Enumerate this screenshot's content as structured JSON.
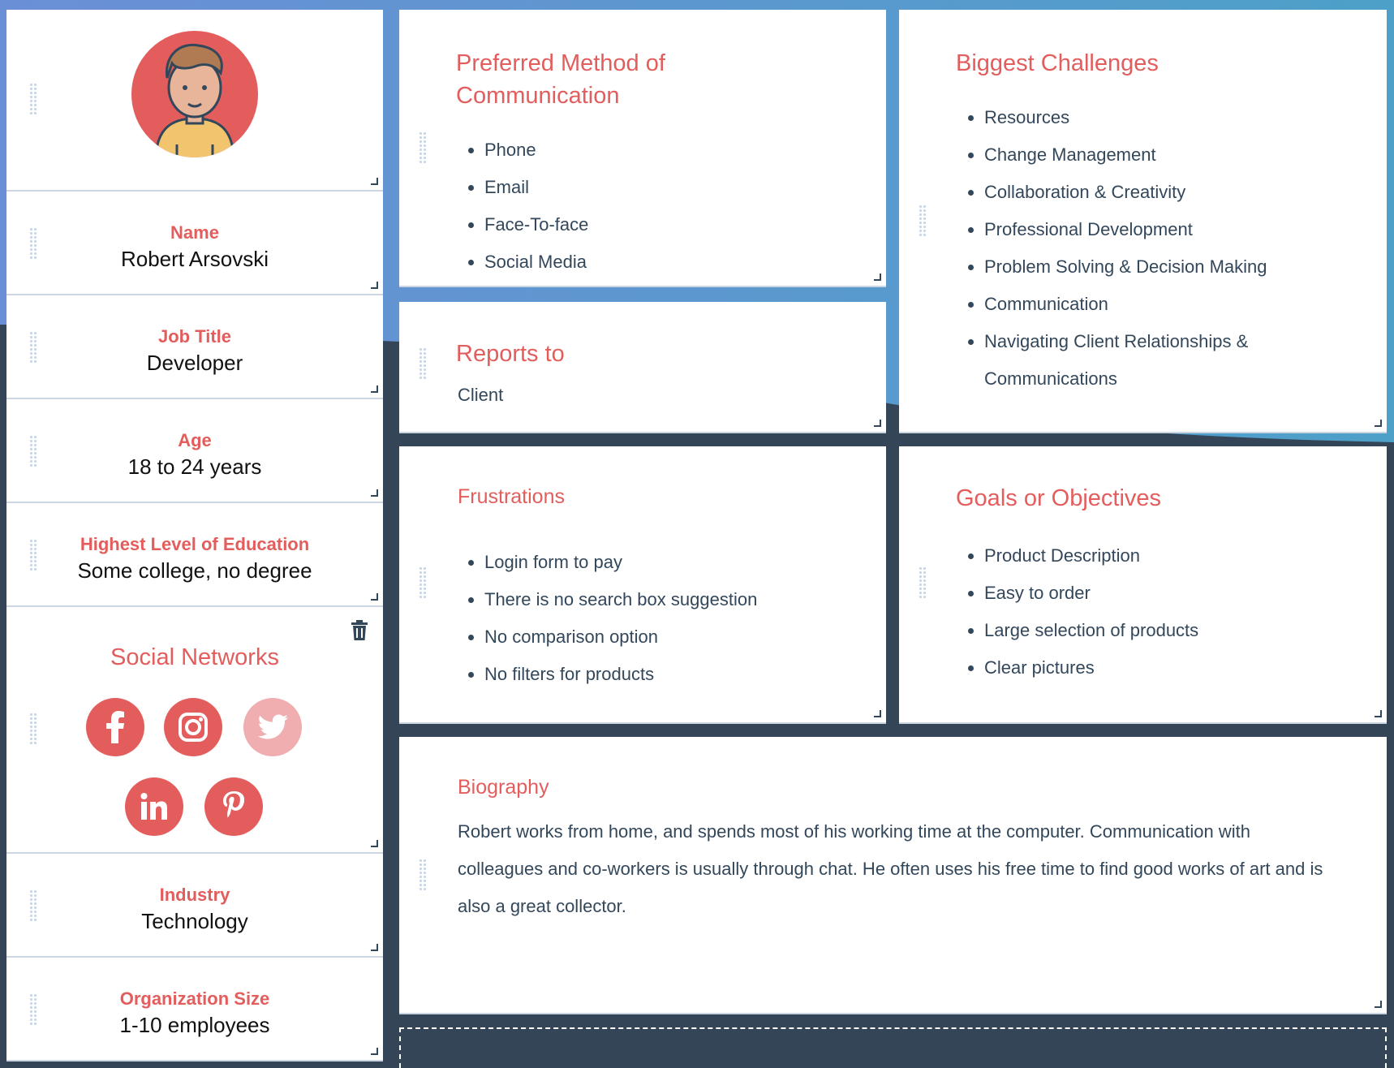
{
  "colors": {
    "accent": "#e35d5d",
    "text": "#33475b",
    "background": "#344558"
  },
  "profile": {
    "avatar_icon": "avatar-developer",
    "fields": [
      {
        "label": "Name",
        "value": "Robert Arsovski"
      },
      {
        "label": "Job Title",
        "value": "Developer"
      },
      {
        "label": "Age",
        "value": "18 to 24 years"
      },
      {
        "label": "Highest Level of Education",
        "value": "Some college, no degree"
      }
    ],
    "social": {
      "title": "Social Networks",
      "icons": [
        "facebook-icon",
        "instagram-icon",
        "twitter-icon",
        "linkedin-icon",
        "pinterest-icon"
      ]
    },
    "industry": {
      "label": "Industry",
      "value": "Technology"
    },
    "org_size": {
      "label": "Organization Size",
      "value": "1-10 employees"
    }
  },
  "communication": {
    "title": "Preferred Method of Communication",
    "items": [
      "Phone",
      "Email",
      "Face-To-face",
      "Social Media"
    ]
  },
  "reports_to": {
    "title": "Reports to",
    "value": "Client"
  },
  "challenges": {
    "title": "Biggest Challenges",
    "items": [
      "Resources",
      "Change Management",
      "Collaboration & Creativity",
      "Professional Development",
      "Problem Solving & Decision Making",
      "Communication",
      "Navigating Client Relationships & Communications"
    ]
  },
  "frustrations": {
    "title": "Frustrations",
    "items": [
      "Login form to pay",
      "There is no search box suggestion",
      "No comparison option",
      "No filters for products"
    ]
  },
  "goals": {
    "title": "Goals or Objectives",
    "items": [
      "Product Description",
      "Easy to order",
      "Large selection of products",
      "Clear pictures"
    ]
  },
  "biography": {
    "title": "Biography",
    "text": "Robert works from home, and spends most of his working time at the computer. Communication with colleagues and co-workers is usually through chat. He often uses his free time to find good works of art and is also a great collector."
  }
}
